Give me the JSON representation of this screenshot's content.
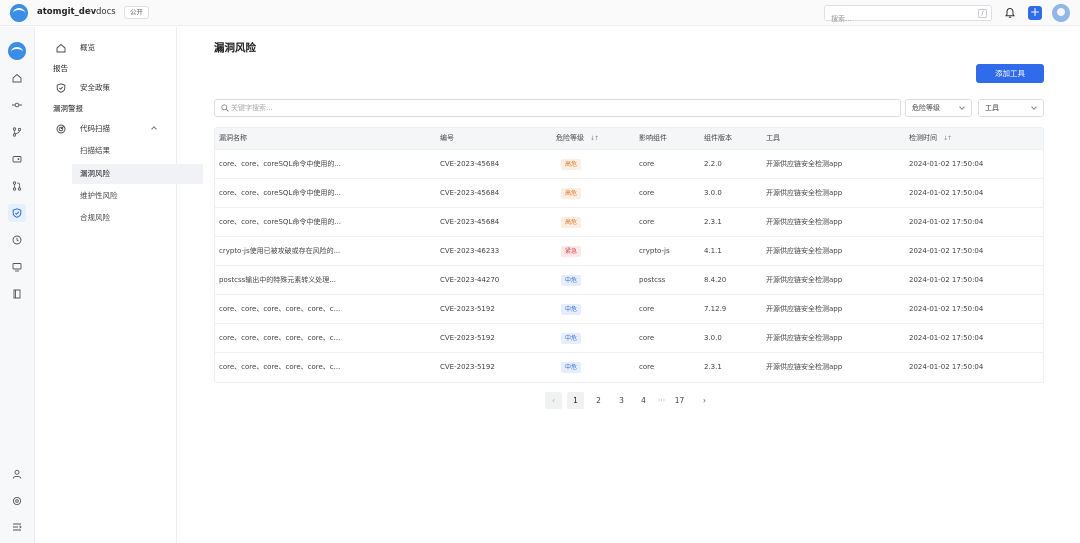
{
  "topbar": {
    "owner": "atomgit_dev",
    "separator": ">",
    "repo": "docs",
    "visibility": "公开",
    "search_placeholder": "搜索...",
    "search_shortcut": "/",
    "new_label": "+"
  },
  "sidebar": {
    "overview": "概览",
    "group_report": "报告",
    "security_policy": "安全政策",
    "group_vuln": "漏洞警报",
    "code_scan": "代码扫描",
    "sub_items": [
      "扫描结果",
      "漏洞风险",
      "维护性风险",
      "合规风险"
    ],
    "active_sub": "漏洞风险"
  },
  "main": {
    "title": "漏洞风险",
    "add_tool": "添加工具",
    "search_placeholder": "关键字搜索...",
    "filter_risk": "危险等级",
    "filter_tool": "工具"
  },
  "table": {
    "headers": [
      "漏洞名称",
      "编号",
      "危险等级",
      "影响组件",
      "组件版本",
      "工具",
      "检测时间"
    ],
    "sort_glyph": "↓↑",
    "rows": [
      {
        "name": "core、core、coreSQL命令中使用的...",
        "id": "CVE-2023-45684",
        "risk": "高危",
        "level": "high",
        "component": "core",
        "version": "2.2.0",
        "tool": "开源供应链安全检测app",
        "time": "2024-01-02 17:50:04"
      },
      {
        "name": "core、core、coreSQL命令中使用的...",
        "id": "CVE-2023-45684",
        "risk": "高危",
        "level": "high",
        "component": "core",
        "version": "3.0.0",
        "tool": "开源供应链安全检测app",
        "time": "2024-01-02 17:50:04"
      },
      {
        "name": "core、core、coreSQL命令中使用的...",
        "id": "CVE-2023-45684",
        "risk": "高危",
        "level": "high",
        "component": "core",
        "version": "2.3.1",
        "tool": "开源供应链安全检测app",
        "time": "2024-01-02 17:50:04"
      },
      {
        "name": "crypto-js使用已被攻破或存在风险的...",
        "id": "CVE-2023-46233",
        "risk": "紧急",
        "level": "urgent",
        "component": "crypto-js",
        "version": "4.1.1",
        "tool": "开源供应链安全检测app",
        "time": "2024-01-02 17:50:04"
      },
      {
        "name": "postcss输出中的特殊元素转义处理...",
        "id": "CVE-2023-44270",
        "risk": "中危",
        "level": "mid",
        "component": "postcss",
        "version": "8.4.20",
        "tool": "开源供应链安全检测app",
        "time": "2024-01-02 17:50:04"
      },
      {
        "name": "core、core、core、core、core、c...",
        "id": "CVE-2023-5192",
        "risk": "中危",
        "level": "mid",
        "component": "core",
        "version": "7.12.9",
        "tool": "开源供应链安全检测app",
        "time": "2024-01-02 17:50:04"
      },
      {
        "name": "core、core、core、core、core、c...",
        "id": "CVE-2023-5192",
        "risk": "中危",
        "level": "mid",
        "component": "core",
        "version": "3.0.0",
        "tool": "开源供应链安全检测app",
        "time": "2024-01-02 17:50:04"
      },
      {
        "name": "core、core、core、core、core、c...",
        "id": "CVE-2023-5192",
        "risk": "中危",
        "level": "mid",
        "component": "core",
        "version": "2.3.1",
        "tool": "开源供应链安全检测app",
        "time": "2024-01-02 17:50:04"
      }
    ]
  },
  "pagination": {
    "prev": "‹",
    "pages": [
      "1",
      "2",
      "3",
      "4"
    ],
    "ellipsis": "···",
    "last": "17",
    "next": "›",
    "current": "1"
  },
  "colors": {
    "accent": "#2f6bea",
    "high": "#e07a2f",
    "urgent": "#d9414a",
    "mid": "#3a6fd8"
  }
}
